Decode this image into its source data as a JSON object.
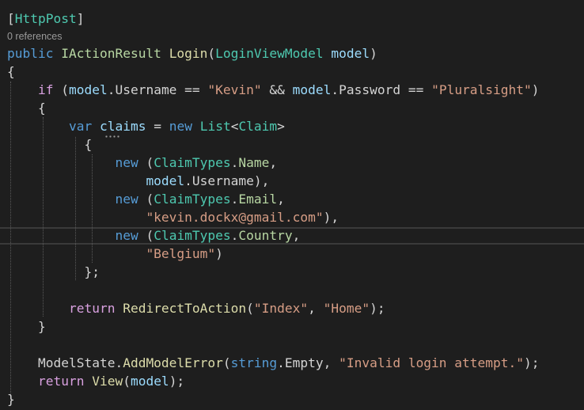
{
  "code_lens": {
    "references": "0 references"
  },
  "lines": [
    [
      {
        "t": "[",
        "c": "#d4d4d4"
      },
      {
        "t": "HttpPost",
        "c": "#4ec9b0"
      },
      {
        "t": "]",
        "c": "#d4d4d4"
      }
    ],
    [
      {
        "t": "public",
        "c": "#569cd6"
      },
      {
        "t": " ",
        "c": "#d4d4d4"
      },
      {
        "t": "IActionResult",
        "c": "#b8d7a3"
      },
      {
        "t": " ",
        "c": "#d4d4d4"
      },
      {
        "t": "Login",
        "c": "#dcdcaa"
      },
      {
        "t": "(",
        "c": "#d4d4d4"
      },
      {
        "t": "LoginViewModel",
        "c": "#4ec9b0"
      },
      {
        "t": " ",
        "c": "#d4d4d4"
      },
      {
        "t": "model",
        "c": "#9cdcfe"
      },
      {
        "t": ")",
        "c": "#d4d4d4"
      }
    ],
    [
      {
        "t": "{",
        "c": "#d4d4d4"
      }
    ],
    [
      {
        "t": "    ",
        "c": "#d4d4d4"
      },
      {
        "t": "if",
        "c": "#d8a0df"
      },
      {
        "t": " (",
        "c": "#d4d4d4"
      },
      {
        "t": "model",
        "c": "#9cdcfe"
      },
      {
        "t": ".Username == ",
        "c": "#d4d4d4"
      },
      {
        "t": "\"Kevin\"",
        "c": "#d69d85"
      },
      {
        "t": " && ",
        "c": "#d4d4d4"
      },
      {
        "t": "model",
        "c": "#9cdcfe"
      },
      {
        "t": ".Password == ",
        "c": "#d4d4d4"
      },
      {
        "t": "\"Pluralsight\"",
        "c": "#d69d85"
      },
      {
        "t": ")",
        "c": "#d4d4d4"
      }
    ],
    [
      {
        "t": "    {",
        "c": "#d4d4d4"
      }
    ],
    [
      {
        "t": "        ",
        "c": "#d4d4d4"
      },
      {
        "t": "var",
        "c": "#569cd6"
      },
      {
        "t": " ",
        "c": "#d4d4d4"
      },
      {
        "t": "claims",
        "c": "#9cdcfe"
      },
      {
        "t": " = ",
        "c": "#d4d4d4"
      },
      {
        "t": "new",
        "c": "#569cd6"
      },
      {
        "t": " ",
        "c": "#d4d4d4"
      },
      {
        "t": "List",
        "c": "#4ec9b0"
      },
      {
        "t": "<",
        "c": "#d4d4d4"
      },
      {
        "t": "Claim",
        "c": "#4ec9b0"
      },
      {
        "t": ">",
        "c": "#d4d4d4"
      }
    ],
    [
      {
        "t": "          {",
        "c": "#d4d4d4"
      }
    ],
    [
      {
        "t": "              ",
        "c": "#d4d4d4"
      },
      {
        "t": "new",
        "c": "#569cd6"
      },
      {
        "t": " (",
        "c": "#d4d4d4"
      },
      {
        "t": "ClaimTypes",
        "c": "#4ec9b0"
      },
      {
        "t": ".",
        "c": "#d4d4d4"
      },
      {
        "t": "Name",
        "c": "#b8d7a3"
      },
      {
        "t": ",",
        "c": "#d4d4d4"
      }
    ],
    [
      {
        "t": "                  ",
        "c": "#d4d4d4"
      },
      {
        "t": "model",
        "c": "#9cdcfe"
      },
      {
        "t": ".Username),",
        "c": "#d4d4d4"
      }
    ],
    [
      {
        "t": "              ",
        "c": "#d4d4d4"
      },
      {
        "t": "new",
        "c": "#569cd6"
      },
      {
        "t": " (",
        "c": "#d4d4d4"
      },
      {
        "t": "ClaimTypes",
        "c": "#4ec9b0"
      },
      {
        "t": ".",
        "c": "#d4d4d4"
      },
      {
        "t": "Email",
        "c": "#b8d7a3"
      },
      {
        "t": ",",
        "c": "#d4d4d4"
      }
    ],
    [
      {
        "t": "                  ",
        "c": "#d4d4d4"
      },
      {
        "t": "\"kevin.dockx@gmail.com\"",
        "c": "#d69d85"
      },
      {
        "t": "),",
        "c": "#d4d4d4"
      }
    ],
    [
      {
        "t": "              ",
        "c": "#d4d4d4"
      },
      {
        "t": "new",
        "c": "#569cd6"
      },
      {
        "t": " (",
        "c": "#d4d4d4"
      },
      {
        "t": "ClaimTypes",
        "c": "#4ec9b0"
      },
      {
        "t": ".",
        "c": "#d4d4d4"
      },
      {
        "t": "Country",
        "c": "#b8d7a3"
      },
      {
        "t": ",",
        "c": "#d4d4d4"
      }
    ],
    [
      {
        "t": "                  ",
        "c": "#d4d4d4"
      },
      {
        "t": "\"Belgium\"",
        "c": "#d69d85"
      },
      {
        "t": ")",
        "c": "#d4d4d4"
      }
    ],
    [
      {
        "t": "          };",
        "c": "#d4d4d4"
      }
    ],
    [],
    [
      {
        "t": "        ",
        "c": "#d4d4d4"
      },
      {
        "t": "return",
        "c": "#d8a0df"
      },
      {
        "t": " ",
        "c": "#d4d4d4"
      },
      {
        "t": "RedirectToAction",
        "c": "#dcdcaa"
      },
      {
        "t": "(",
        "c": "#d4d4d4"
      },
      {
        "t": "\"Index\"",
        "c": "#d69d85"
      },
      {
        "t": ", ",
        "c": "#d4d4d4"
      },
      {
        "t": "\"Home\"",
        "c": "#d69d85"
      },
      {
        "t": ");",
        "c": "#d4d4d4"
      }
    ],
    [
      {
        "t": "    }",
        "c": "#d4d4d4"
      }
    ],
    [],
    [
      {
        "t": "    ",
        "c": "#d4d4d4"
      },
      {
        "t": "ModelState",
        "c": "#d4d4d4"
      },
      {
        "t": ".",
        "c": "#d4d4d4"
      },
      {
        "t": "AddModelError",
        "c": "#dcdcaa"
      },
      {
        "t": "(",
        "c": "#d4d4d4"
      },
      {
        "t": "string",
        "c": "#569cd6"
      },
      {
        "t": ".Empty, ",
        "c": "#d4d4d4"
      },
      {
        "t": "\"Invalid login attempt.\"",
        "c": "#d69d85"
      },
      {
        "t": ");",
        "c": "#d4d4d4"
      }
    ],
    [
      {
        "t": "    ",
        "c": "#d4d4d4"
      },
      {
        "t": "return",
        "c": "#d8a0df"
      },
      {
        "t": " ",
        "c": "#d4d4d4"
      },
      {
        "t": "View",
        "c": "#dcdcaa"
      },
      {
        "t": "(",
        "c": "#d4d4d4"
      },
      {
        "t": "model",
        "c": "#9cdcfe"
      },
      {
        "t": ");",
        "c": "#d4d4d4"
      }
    ],
    [
      {
        "t": "}",
        "c": "#d4d4d4"
      }
    ]
  ]
}
